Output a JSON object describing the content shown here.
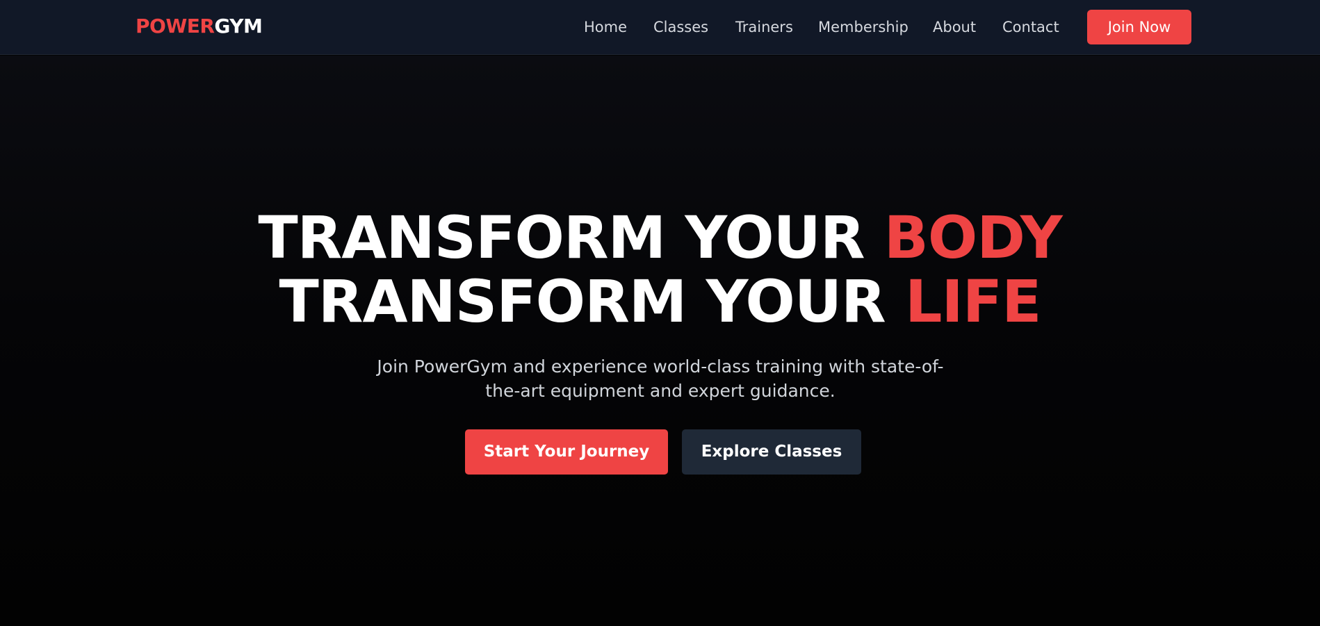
{
  "brand": {
    "part1": "POWER",
    "part2": "GYM"
  },
  "nav": {
    "items": [
      {
        "label": "Home"
      },
      {
        "label": "Classes"
      },
      {
        "label": "Trainers"
      },
      {
        "label": "Membership"
      },
      {
        "label": "About"
      },
      {
        "label": "Contact"
      }
    ],
    "cta_label": "Join Now"
  },
  "hero": {
    "line1_text": "TRANSFORM YOUR ",
    "line1_accent": "BODY",
    "line2_text": "TRANSFORM YOUR ",
    "line2_accent": "LIFE",
    "subtitle": "Join PowerGym and experience world-class training with state-of-the-art equipment and expert guidance.",
    "primary_button": "Start Your Journey",
    "secondary_button": "Explore Classes"
  },
  "colors": {
    "accent": "#ef4444",
    "nav_background": "#111827",
    "secondary_button": "#1f2937",
    "hero_background": "#030303"
  }
}
